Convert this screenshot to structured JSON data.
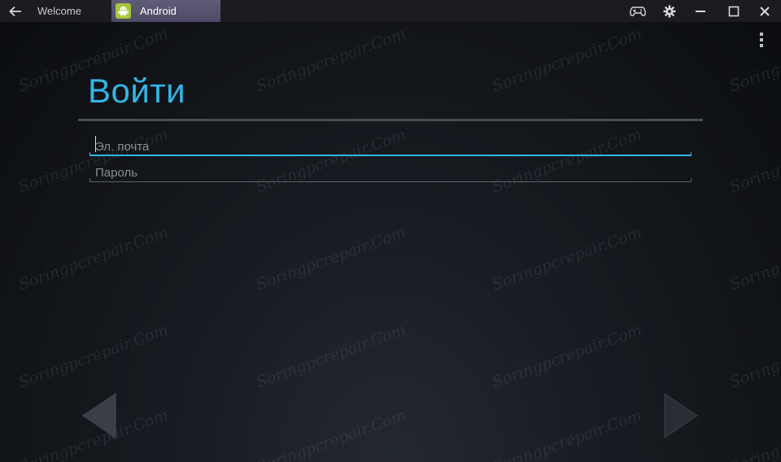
{
  "titlebar": {
    "tabs": [
      {
        "label": "Welcome"
      },
      {
        "label": "Android"
      }
    ],
    "icons": {
      "back": "arrow-left-icon",
      "gamepad": "gamepad-icon",
      "settings": "gear-icon",
      "minimize": "minimize-icon",
      "maximize": "maximize-icon",
      "close": "close-icon"
    }
  },
  "screen": {
    "title": "Войти",
    "email": {
      "placeholder": "Эл. почта",
      "value": ""
    },
    "password": {
      "placeholder": "Пароль",
      "value": ""
    },
    "watermark": "Soringpcrepair.Com"
  },
  "colors": {
    "accent": "#33b5e5",
    "titlebar_bg": "#1c1c20",
    "active_tab": "#5f5c78",
    "android_icon": "#a4c639"
  }
}
